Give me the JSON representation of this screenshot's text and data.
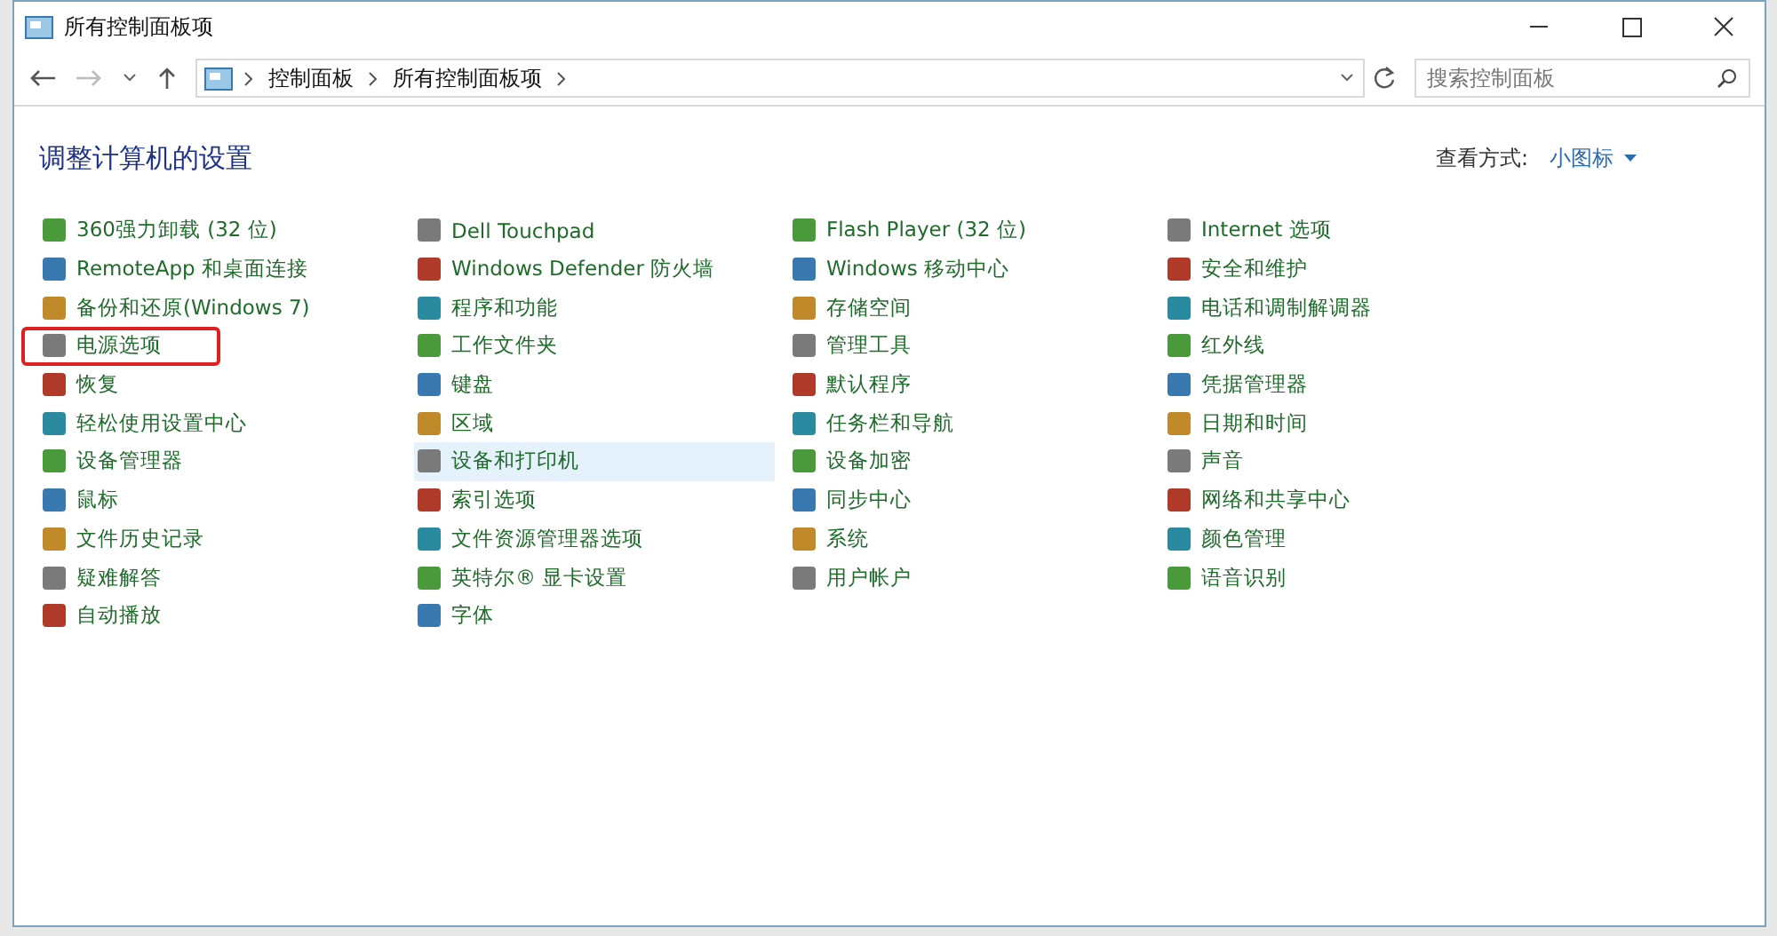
{
  "window": {
    "title": "所有控制面板项"
  },
  "address_bar": {
    "breadcrumbs": [
      "控制面板",
      "所有控制面板项"
    ]
  },
  "search": {
    "placeholder": "搜索控制面板"
  },
  "heading": "调整计算机的设置",
  "view_by": {
    "label": "查看方式:",
    "value": "小图标"
  },
  "columns": [
    [
      {
        "label": "360强力卸载 (32 位)",
        "highlighted": false,
        "marked": false
      },
      {
        "label": "RemoteApp 和桌面连接",
        "highlighted": false,
        "marked": false
      },
      {
        "label": "备份和还原(Windows 7)",
        "highlighted": false,
        "marked": false
      },
      {
        "label": "电源选项",
        "highlighted": false,
        "marked": true
      },
      {
        "label": "恢复",
        "highlighted": false,
        "marked": false
      },
      {
        "label": "轻松使用设置中心",
        "highlighted": false,
        "marked": false
      },
      {
        "label": "设备管理器",
        "highlighted": false,
        "marked": false
      },
      {
        "label": "鼠标",
        "highlighted": false,
        "marked": false
      },
      {
        "label": "文件历史记录",
        "highlighted": false,
        "marked": false
      },
      {
        "label": "疑难解答",
        "highlighted": false,
        "marked": false
      },
      {
        "label": "自动播放",
        "highlighted": false,
        "marked": false
      }
    ],
    [
      {
        "label": "Dell Touchpad",
        "highlighted": false,
        "marked": false
      },
      {
        "label": "Windows Defender 防火墙",
        "highlighted": false,
        "marked": false
      },
      {
        "label": "程序和功能",
        "highlighted": false,
        "marked": false
      },
      {
        "label": "工作文件夹",
        "highlighted": false,
        "marked": false
      },
      {
        "label": "键盘",
        "highlighted": false,
        "marked": false
      },
      {
        "label": "区域",
        "highlighted": false,
        "marked": false
      },
      {
        "label": "设备和打印机",
        "highlighted": true,
        "marked": false
      },
      {
        "label": "索引选项",
        "highlighted": false,
        "marked": false
      },
      {
        "label": "文件资源管理器选项",
        "highlighted": false,
        "marked": false
      },
      {
        "label": "英特尔® 显卡设置",
        "highlighted": false,
        "marked": false
      },
      {
        "label": "字体",
        "highlighted": false,
        "marked": false
      }
    ],
    [
      {
        "label": "Flash Player (32 位)",
        "highlighted": false,
        "marked": false
      },
      {
        "label": "Windows 移动中心",
        "highlighted": false,
        "marked": false
      },
      {
        "label": "存储空间",
        "highlighted": false,
        "marked": false
      },
      {
        "label": "管理工具",
        "highlighted": false,
        "marked": false
      },
      {
        "label": "默认程序",
        "highlighted": false,
        "marked": false
      },
      {
        "label": "任务栏和导航",
        "highlighted": false,
        "marked": false
      },
      {
        "label": "设备加密",
        "highlighted": false,
        "marked": false
      },
      {
        "label": "同步中心",
        "highlighted": false,
        "marked": false
      },
      {
        "label": "系统",
        "highlighted": false,
        "marked": false
      },
      {
        "label": "用户帐户",
        "highlighted": false,
        "marked": false
      }
    ],
    [
      {
        "label": "Internet 选项",
        "highlighted": false,
        "marked": false
      },
      {
        "label": "安全和维护",
        "highlighted": false,
        "marked": false
      },
      {
        "label": "电话和调制解调器",
        "highlighted": false,
        "marked": false
      },
      {
        "label": "红外线",
        "highlighted": false,
        "marked": false
      },
      {
        "label": "凭据管理器",
        "highlighted": false,
        "marked": false
      },
      {
        "label": "日期和时间",
        "highlighted": false,
        "marked": false
      },
      {
        "label": "声音",
        "highlighted": false,
        "marked": false
      },
      {
        "label": "网络和共享中心",
        "highlighted": false,
        "marked": false
      },
      {
        "label": "颜色管理",
        "highlighted": false,
        "marked": false
      },
      {
        "label": "语音识别",
        "highlighted": false,
        "marked": false
      }
    ]
  ]
}
